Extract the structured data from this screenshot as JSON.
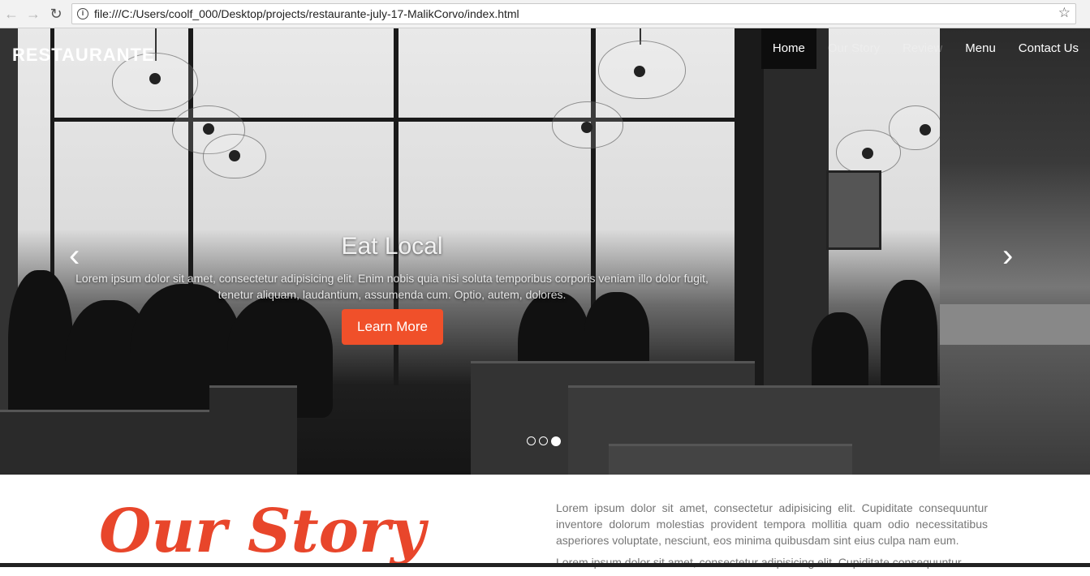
{
  "browser": {
    "url": "file:///C:/Users/coolf_000/Desktop/projects/restaurante-july-17-MalikCorvo/index.html",
    "back_icon": "←",
    "forward_icon": "→",
    "reload_icon": "↻",
    "info_icon": "i",
    "star_icon": "☆"
  },
  "navbar": {
    "brand": "RESTAURANTE",
    "items": [
      "Home",
      "Our Story",
      "Review",
      "Menu",
      "Contact Us"
    ],
    "active_index": 0
  },
  "carousel": {
    "title": "Eat Local",
    "text": "Lorem ipsum dolor sit amet, consectetur adipisicing elit. Enim nobis quia nisi soluta temporibus corporis veniam illo dolor fugit, tenetur aliquam, laudantium, assumenda cum. Optio, autem, dolores.",
    "button_label": "Learn More",
    "prev_icon": "‹",
    "next_icon": "›",
    "indicator_count": 3,
    "active_indicator": 2
  },
  "story": {
    "title": "Our Story",
    "paragraph_1": "Lorem ipsum dolor sit amet, consectetur adipisicing elit. Cupiditate consequuntur inventore dolorum molestias provident tempora mollitia quam odio necessitatibus asperiores voluptate, nesciunt, eos minima quibusdam sint eius culpa nam eum.",
    "paragraph_2": "Lorem ipsum dolor sit amet, consectetur adipisicing elit. Cupiditate consequuntur"
  },
  "colors": {
    "accent": "#f0502a",
    "story_title": "#e8462b"
  }
}
